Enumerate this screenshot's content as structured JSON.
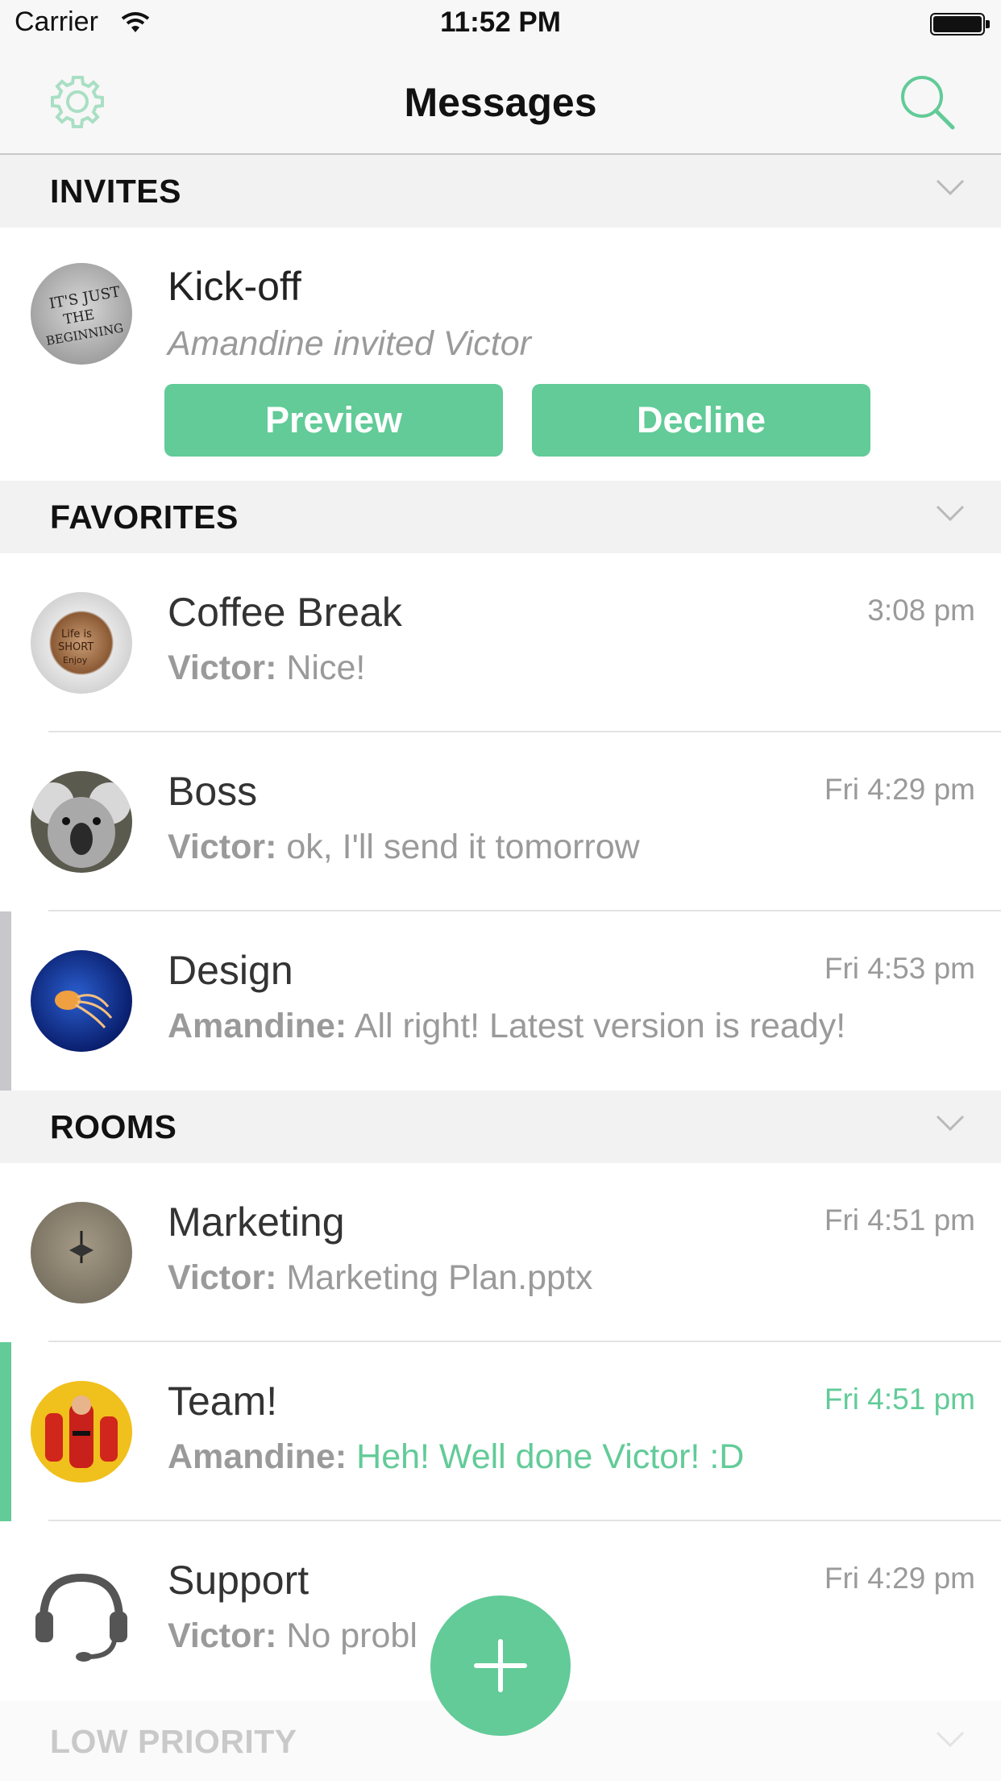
{
  "status_bar": {
    "carrier": "Carrier",
    "time": "11:52 PM"
  },
  "nav": {
    "title": "Messages",
    "left_icon": "gear-icon",
    "right_icon": "search-icon"
  },
  "sections": {
    "invites": "INVITES",
    "favorites": "FAVORITES",
    "rooms": "ROOMS",
    "low_priority": "LOW PRIORITY"
  },
  "invite": {
    "name": "Kick-off",
    "subtitle": "Amandine invited Victor",
    "avatar_text": "IT'S JUST THE BEGINNING",
    "preview_label": "Preview",
    "decline_label": "Decline"
  },
  "favorites": [
    {
      "title": "Coffee Break",
      "time": "3:08 pm",
      "sender": "Victor:",
      "message": " Nice!",
      "avatar_text": "Life is SHORT Enjoy coffee"
    },
    {
      "title": "Boss",
      "time": "Fri 4:29 pm",
      "sender": "Victor:",
      "message": " ok, I'll send it tomorrow"
    },
    {
      "title": "Design",
      "time": "Fri 4:53 pm",
      "sender": "Amandine:",
      "message": " All right! Latest version is ready!"
    }
  ],
  "rooms": [
    {
      "title": "Marketing",
      "time": "Fri 4:51 pm",
      "sender": "Victor:",
      "message": " Marketing Plan.pptx"
    },
    {
      "title": "Team!",
      "time": "Fri 4:51 pm",
      "sender": "Amandine:",
      "message": " Heh! Well done Victor! :D"
    },
    {
      "title": "Support",
      "time": "Fri 4:29 pm",
      "sender": "Victor:",
      "message": " No probl"
    }
  ],
  "colors": {
    "accent": "#62cb98",
    "unread_marker_grey": "#c7c7cc",
    "section_bg": "#f2f2f2"
  }
}
